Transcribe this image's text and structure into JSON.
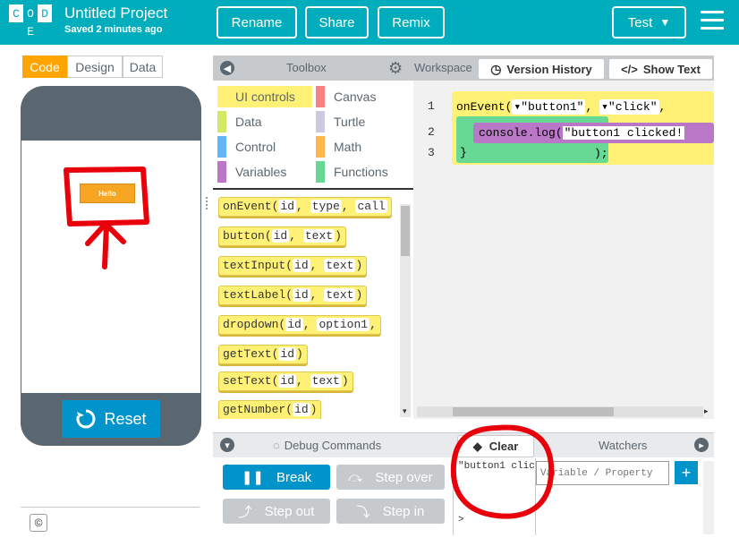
{
  "header": {
    "logo_letters": [
      "C",
      "O",
      "D",
      "E"
    ],
    "title": "Untitled Project",
    "saved": "Saved 2 minutes ago",
    "rename": "Rename",
    "share": "Share",
    "remix": "Remix",
    "test": "Test"
  },
  "left_tabs": [
    "Code",
    "Design",
    "Data"
  ],
  "app": {
    "button_text": "Hello",
    "reset": "Reset",
    "copyright": "©"
  },
  "toolbox": {
    "title": "Toolbox",
    "categories": [
      {
        "label": "UI controls",
        "color": "#fff176"
      },
      {
        "label": "Canvas",
        "color": "#f78183"
      },
      {
        "label": "Data",
        "color": "#d3e965"
      },
      {
        "label": "Turtle",
        "color": "#cfc9de"
      },
      {
        "label": "Control",
        "color": "#64b5f6"
      },
      {
        "label": "Math",
        "color": "#ffb74d"
      },
      {
        "label": "Variables",
        "color": "#bb77c7"
      },
      {
        "label": "Functions",
        "color": "#68d995"
      }
    ],
    "blocks": [
      {
        "name": "onEvent",
        "args": [
          "id",
          "type",
          "call"
        ]
      },
      {
        "name": "button",
        "args": [
          "id",
          "text"
        ]
      },
      {
        "name": "textInput",
        "args": [
          "id",
          "text"
        ]
      },
      {
        "name": "textLabel",
        "args": [
          "id",
          "text"
        ]
      },
      {
        "name": "dropdown",
        "args": [
          "id",
          "option1",
          ""
        ]
      },
      {
        "name": "getText",
        "args": [
          "id"
        ]
      },
      {
        "name": "setText",
        "args": [
          "id",
          "text"
        ]
      },
      {
        "name": "getNumber",
        "args": [
          "id"
        ]
      }
    ]
  },
  "workspace": {
    "title": "Workspace",
    "version_history": "Version History",
    "show_text": "Show Text",
    "line_numbers": [
      "1",
      "2",
      "3"
    ],
    "line1": {
      "fn": "onEvent(",
      "arg1": "\"button1\"",
      "sep": ",",
      "arg2": "\"click\"",
      "tail": ","
    },
    "line2": {
      "fn": "console.log(",
      "arg": "\"button1 clicked!"
    },
    "line3": {
      "brace": "}",
      "tail": ");"
    }
  },
  "debug": {
    "commands_title": "Debug Commands",
    "clear": "Clear",
    "watchers": "Watchers",
    "break": "Break",
    "step_over": "Step over",
    "step_out": "Step out",
    "step_in": "Step in",
    "console_output": "\"button1 clic",
    "prompt": ">",
    "watch_placeholder": "Variable / Property",
    "add": "+"
  },
  "annotation_color": "#e8000b"
}
